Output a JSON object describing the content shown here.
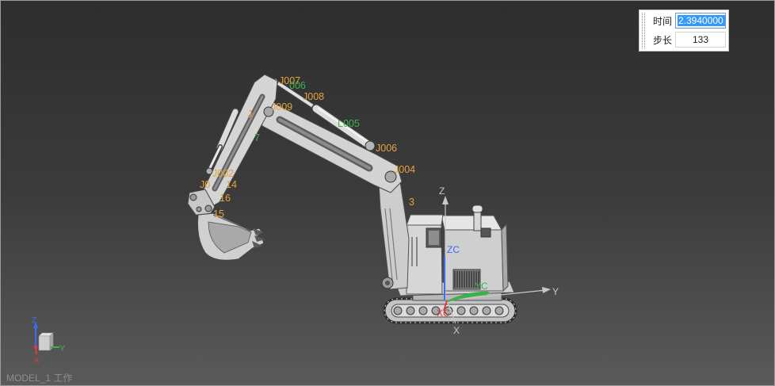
{
  "status_bar": {
    "model_label": "MODEL_1 工作"
  },
  "sim_panel": {
    "time_label": "时间",
    "time_value": "2.3940000",
    "step_label": "步长",
    "step_value": "133"
  },
  "model_labels": {
    "j007": "J007",
    "green_006": "006",
    "j008": "J008",
    "j009": "J009",
    "j_fragment": "J",
    "l005": "L005",
    "green_7": "7",
    "j006": "J006",
    "j004": "J004",
    "j002": "J002",
    "j0_fragment": "J0",
    "frag_14": "14",
    "frag_16": "16",
    "frag_15": "15",
    "frag_3": "3"
  },
  "world_axes": {
    "z": "Z",
    "y": "Y",
    "x": "X"
  },
  "work_axes": {
    "zc": "ZC",
    "yc": "YC",
    "xc": "XC"
  },
  "view_triad": {
    "z": "Z",
    "y": "Y",
    "x": "X"
  },
  "icons": {
    "triad": "axis-triad-icon",
    "grip": "drag-grip-icon"
  },
  "colors": {
    "joint_label": "#e6a33c",
    "link_label": "#3fb34f",
    "axis_x": "#e0393e",
    "axis_y": "#3ab24a",
    "axis_z": "#3c6cf0",
    "axis_neutral": "#c8c8c8",
    "selection": "#3399ff",
    "background_top": "#2e2e2e",
    "background_mid": "#3b3b3b",
    "background_bottom": "#5a5a5a"
  }
}
